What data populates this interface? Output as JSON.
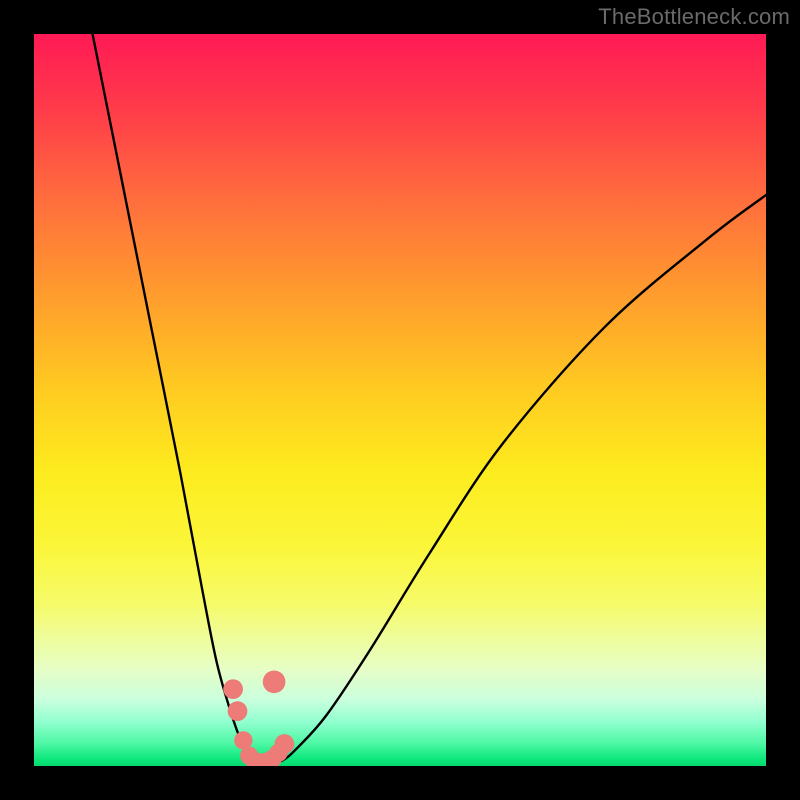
{
  "watermark": "TheBottleneck.com",
  "chart_data": {
    "type": "line",
    "title": "",
    "xlabel": "",
    "ylabel": "",
    "xlim": [
      0,
      100
    ],
    "ylim": [
      0,
      100
    ],
    "series": [
      {
        "name": "bottleneck-curve",
        "x": [
          8,
          12,
          16,
          20,
          23,
          25,
          27,
          28.5,
          30,
          31,
          32,
          34,
          36,
          40,
          46,
          54,
          64,
          78,
          92,
          100
        ],
        "y": [
          100,
          80,
          60,
          40,
          24,
          14,
          7,
          3,
          0.8,
          0.3,
          0.3,
          0.8,
          2.5,
          7,
          16,
          29,
          44,
          60,
          72,
          78
        ]
      }
    ],
    "markers": {
      "name": "highlight-points",
      "color": "#ed7b78",
      "x": [
        27.2,
        27.8,
        28.6,
        29.4,
        30.2,
        31.0,
        31.8,
        32.6,
        33.4,
        34.2,
        32.8
      ],
      "y": [
        10.5,
        7.5,
        3.5,
        1.4,
        0.6,
        0.5,
        0.6,
        1.0,
        1.8,
        3.0,
        11.5
      ],
      "r": [
        1.35,
        1.35,
        1.25,
        1.25,
        1.25,
        1.25,
        1.25,
        1.25,
        1.25,
        1.35,
        1.55
      ]
    },
    "gradient_background": {
      "top": "#ff1a55",
      "middle": "#fdec1e",
      "bottom": "#06d86d"
    }
  }
}
